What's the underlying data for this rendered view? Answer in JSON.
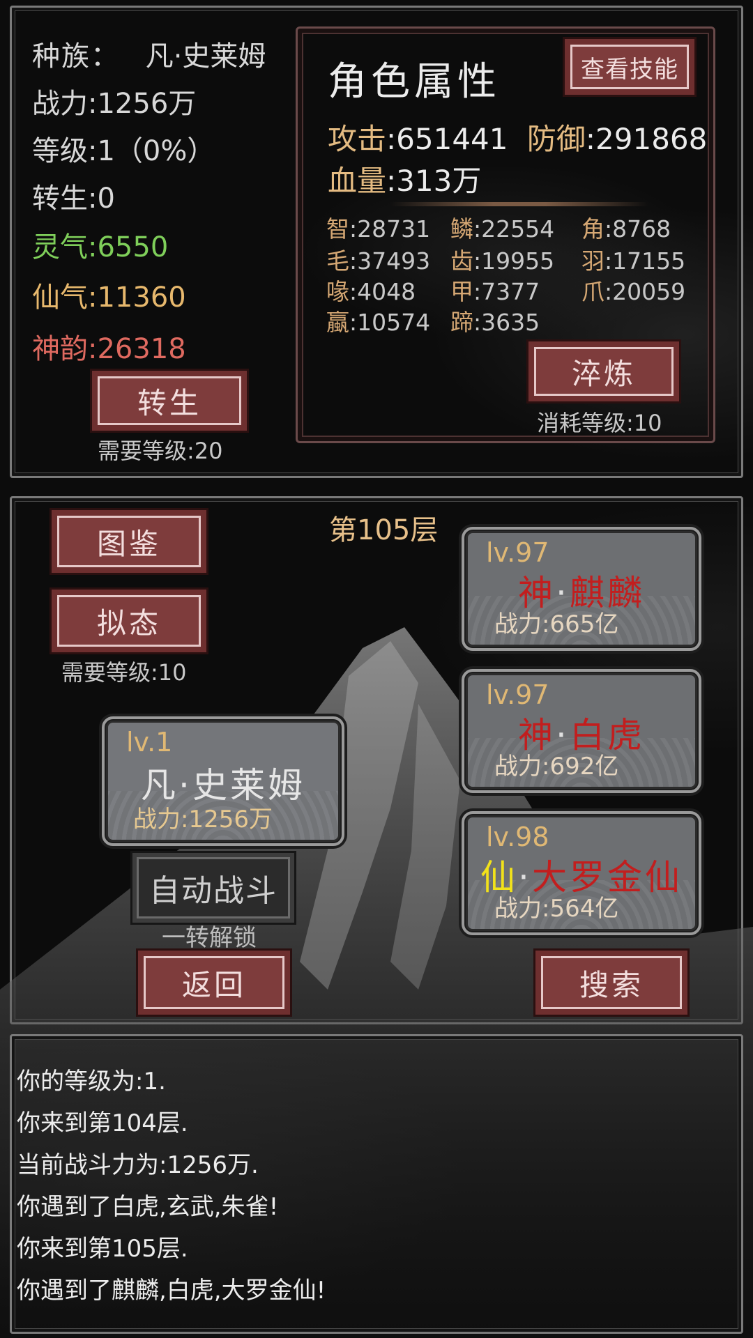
{
  "player_info": {
    "race_label": "种族：",
    "race_value": "凡·史莱姆",
    "power_label": "战力",
    "power_value": ":1256万",
    "level_label": "等级",
    "level_value": ":1（0%）",
    "rebirth_label": "转生",
    "rebirth_value": ":0",
    "lingqi_label": "灵气",
    "lingqi_value": ":6550",
    "xianqi_label": "仙气",
    "xianqi_value": ":11360",
    "shenyun_label": "神韵",
    "shenyun_value": ":26318",
    "rebirth_button": "转生",
    "rebirth_requirement": "需要等级:20"
  },
  "attributes": {
    "title": "角色属性",
    "view_skills_button": "查看技能",
    "attack_label": "攻击",
    "attack_value": ":651441",
    "defense_label": "防御",
    "defense_value": ":291868",
    "hp_label": "血量",
    "hp_value": ":313万",
    "stats": [
      {
        "k": "智",
        "v": ":28731"
      },
      {
        "k": "鳞",
        "v": ":22554"
      },
      {
        "k": "角",
        "v": ":8768"
      },
      {
        "k": "毛",
        "v": ":37493"
      },
      {
        "k": "齿",
        "v": ":19955"
      },
      {
        "k": "羽",
        "v": ":17155"
      },
      {
        "k": "喙",
        "v": ":4048"
      },
      {
        "k": "甲",
        "v": ":7377"
      },
      {
        "k": "爪",
        "v": ":20059"
      },
      {
        "k": "蠃",
        "v": ":10574"
      },
      {
        "k": "蹄",
        "v": ":3635"
      }
    ],
    "refine_button": "淬炼",
    "refine_cost": "消耗等级:10"
  },
  "battle": {
    "floor_label": "第105层",
    "codex_button": "图鉴",
    "mimic_button": "拟态",
    "mimic_requirement": "需要等级:10",
    "player_card": {
      "level": "lv.1",
      "name": "凡·史莱姆",
      "power": "战力:1256万"
    },
    "auto_battle_button": "自动战斗",
    "auto_battle_note": "一转解锁",
    "back_button": "返回",
    "search_button": "搜索",
    "enemies": [
      {
        "level": "lv.97",
        "prefix": "神",
        "sep": "·",
        "name": "麒麟",
        "power": "战力:665亿",
        "prefix_color": "#c21e1e",
        "name_color": "#c21e1e"
      },
      {
        "level": "lv.97",
        "prefix": "神",
        "sep": "·",
        "name": "白虎",
        "power": "战力:692亿",
        "prefix_color": "#c21e1e",
        "name_color": "#c21e1e"
      },
      {
        "level": "lv.98",
        "prefix": "仙",
        "sep": "·",
        "name": "大罗金仙",
        "power": "战力:564亿",
        "prefix_color": "#f2e21a",
        "name_color": "#c21e1e"
      }
    ]
  },
  "log": [
    "你的等级为:1.",
    "你来到第104层.",
    "当前战斗力为:1256万.",
    "你遇到了白虎,玄武,朱雀!",
    "你来到第105层.",
    "你遇到了麒麟,白虎,大罗金仙!"
  ],
  "colors": {
    "button_red": "#7e3c3c",
    "card_gray": "#6d6f72",
    "gold_text": "#e4bb82",
    "green_text": "#7fcf5a",
    "red_text": "#e06a60"
  }
}
